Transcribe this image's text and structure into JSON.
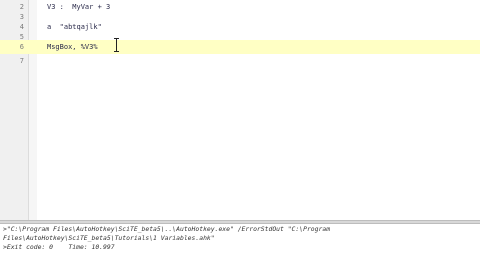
{
  "editor": {
    "lines": [
      {
        "number": "2",
        "text": "V3 :  MyVar + 3"
      },
      {
        "number": "3",
        "text": ""
      },
      {
        "number": "4",
        "text": "a  \"abtqajlk\""
      },
      {
        "number": "5",
        "text": ""
      },
      {
        "number": "6",
        "text": "MsgBox, %V3%"
      },
      {
        "number": "7",
        "text": ""
      }
    ]
  },
  "output": {
    "lines": [
      ">\"C:\\Program Files\\AutoHotkey\\SciTE_beta5\\..\\AutoHotkey.exe\" /ErrorStdOut \"C:\\Program",
      "Files\\AutoHotkey\\SciTE_beta5\\Tutorials\\1 Variables.ahk\"",
      ">Exit code: 0    Time: 10.997"
    ]
  }
}
